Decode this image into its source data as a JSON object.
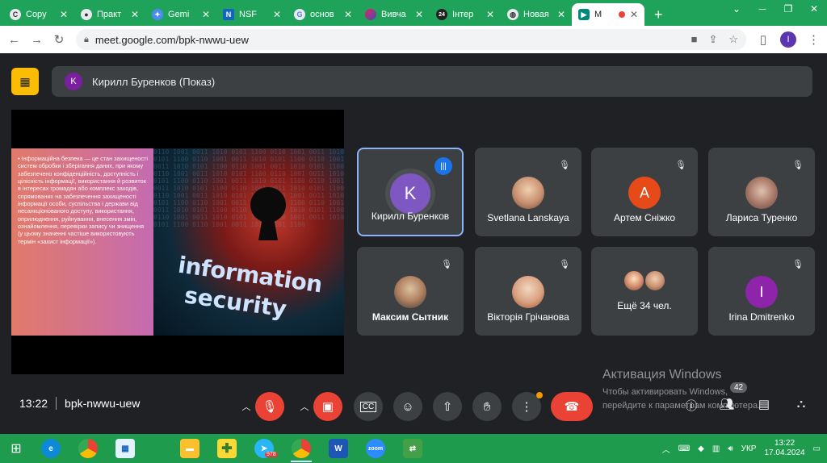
{
  "browser": {
    "tabs": [
      {
        "label": "Copy",
        "icon": "c"
      },
      {
        "label": "Практ",
        "icon": "p"
      },
      {
        "label": "Gemi",
        "icon": "g"
      },
      {
        "label": "NSF",
        "icon": "n"
      },
      {
        "label": "основ",
        "icon": "G"
      },
      {
        "label": "Вивча",
        "icon": "v"
      },
      {
        "label": "Інтер",
        "icon": "24"
      },
      {
        "label": "Новая",
        "icon": "n"
      },
      {
        "label": "M",
        "icon": "m",
        "active": true
      }
    ],
    "new_tab": "+",
    "url": "meet.google.com/bpk-nwwu-uew",
    "profile_initial": "I"
  },
  "meet": {
    "presenter_initial": "K",
    "presenter_label": "Кирилл Буренков (Показ)",
    "slide_text": "• Інформаційна безпека — це стан захищеності систем обробки і зберігання даних, при якому забезпечено конфіденційність, доступність і цілісність інформації, використання й розвиток в інтересах громадян або комплекс заходів, спрямованих на забезпечення захищеності інформації особи, суспільства і держави від несанкціонованого доступу, використання, оприлюднення, руйнування, внесення змін, ознайомлення, перевірки запису чи знищення (у цьому значенні частіше використовують термін «захист інформації»).",
    "slide_art_word1": "information",
    "slide_art_word2": "security",
    "tiles": [
      {
        "name": "Кирилл Буренков",
        "initial": "K",
        "color": "#7e57c2"
      },
      {
        "name": "Svetlana Lanskaya"
      },
      {
        "name": "Артем Сніжко",
        "initial": "А",
        "color": "#e64a19"
      },
      {
        "name": "Лариса Туренко"
      },
      {
        "name": "Максим Сытник"
      },
      {
        "name": "Вікторія Грічанова"
      },
      {
        "name": "Ещё 34 чел."
      },
      {
        "name": "Irina Dmitrenko",
        "initial": "I",
        "color": "#8e24aa"
      }
    ],
    "time": "13:22",
    "meeting_code": "bpk-nwwu-uew",
    "people_count": "42"
  },
  "activation": {
    "title": "Активация Windows",
    "line1": "Чтобы активировать Windows,",
    "line2": "перейдите к параметрам компьютера."
  },
  "taskbar": {
    "telegram_badge": "978",
    "lang": "УКР",
    "time": "13:22",
    "date": "17.04.2024"
  },
  "colors": {
    "tab_strip": "#1fa35a",
    "meet_bg": "#202124",
    "end_call": "#ea4335",
    "presenting": "#fbbc04",
    "speaking_border": "#8ab4f8"
  }
}
